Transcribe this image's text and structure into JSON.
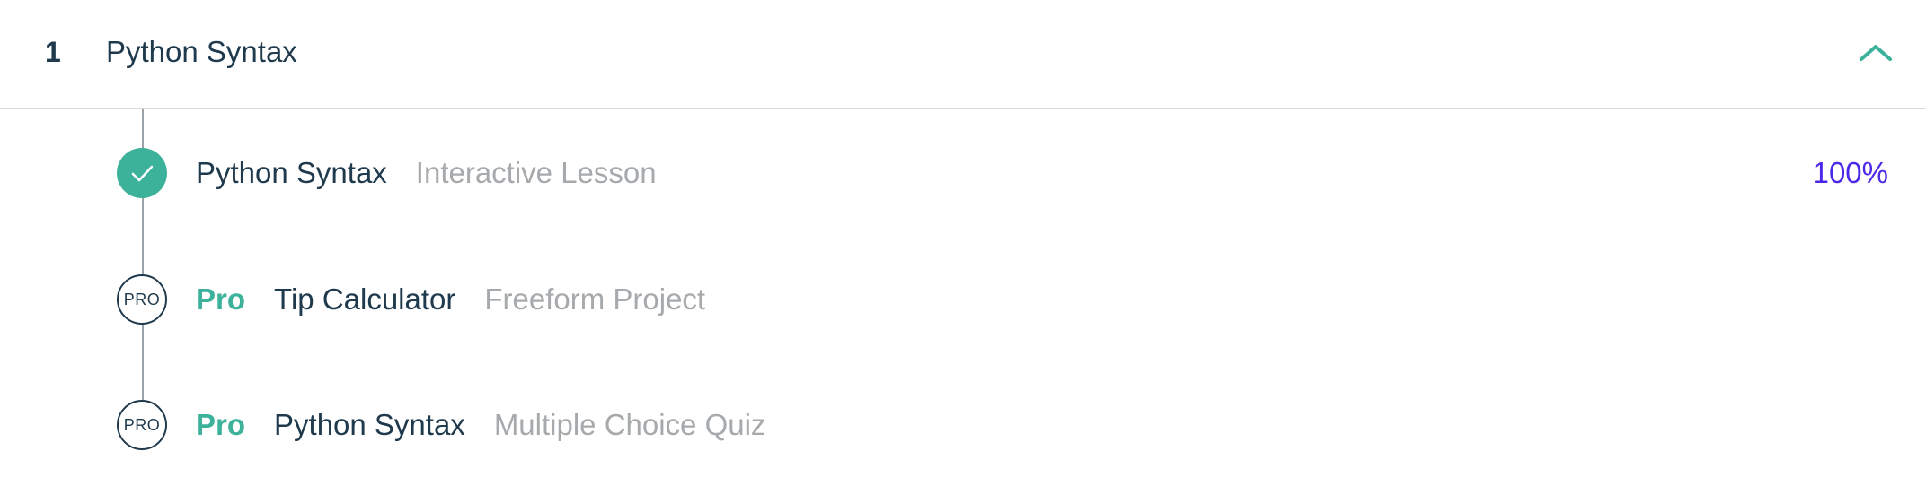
{
  "section": {
    "number": "1",
    "title": "Python Syntax",
    "accent_color": "#3db29b"
  },
  "lessons": [
    {
      "status": "completed",
      "icon": "check-icon",
      "pro_label": "",
      "title": "Python Syntax",
      "type": "Interactive Lesson",
      "progress": "100%"
    },
    {
      "status": "locked",
      "icon": "pro-badge-icon",
      "icon_text": "PRO",
      "pro_label": "Pro",
      "title": "Tip Calculator",
      "type": "Freeform Project"
    },
    {
      "status": "locked",
      "icon": "pro-badge-icon",
      "icon_text": "PRO",
      "pro_label": "Pro",
      "title": "Python Syntax",
      "type": "Multiple Choice Quiz"
    }
  ],
  "colors": {
    "progress": "#4b27e8",
    "pro": "#3db29b",
    "muted_text": "#a7aaad"
  }
}
